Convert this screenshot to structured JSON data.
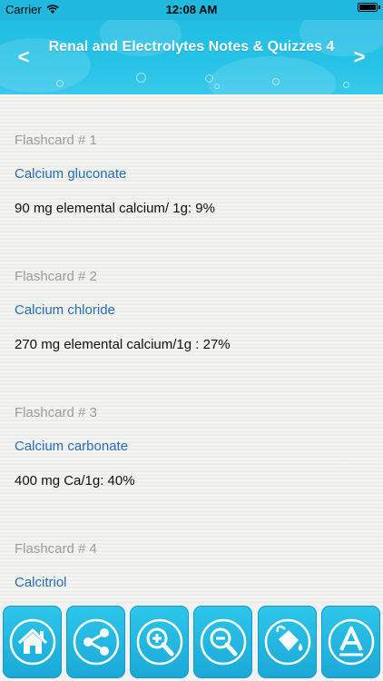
{
  "status_bar": {
    "carrier": "Carrier",
    "time": "12:08 AM",
    "battery": "full"
  },
  "header": {
    "title": "Renal and Electrolytes Notes & Quizzes 4",
    "prev_label": "<",
    "next_label": ">",
    "bg_color": "#27c3e7"
  },
  "cards": [
    {
      "label": "Flashcard # 1",
      "term": "Calcium gluconate",
      "definition": "90 mg elemental calcium/ 1g: 9%"
    },
    {
      "label": "Flashcard # 2",
      "term": "Calcium chloride",
      "definition": "270 mg elemental calcium/1g : 27%"
    },
    {
      "label": "Flashcard # 3",
      "term": "Calcium carbonate",
      "definition": "400 mg Ca/1g: 40%"
    },
    {
      "label": "Flashcard # 4",
      "term": "Calcitriol",
      "definition": ""
    }
  ],
  "toolbar": {
    "buttons": [
      "home-icon",
      "share-icon",
      "zoom-in-icon",
      "zoom-out-icon",
      "paint-bucket-icon",
      "font-icon"
    ],
    "accent": "#1fb4e0"
  }
}
